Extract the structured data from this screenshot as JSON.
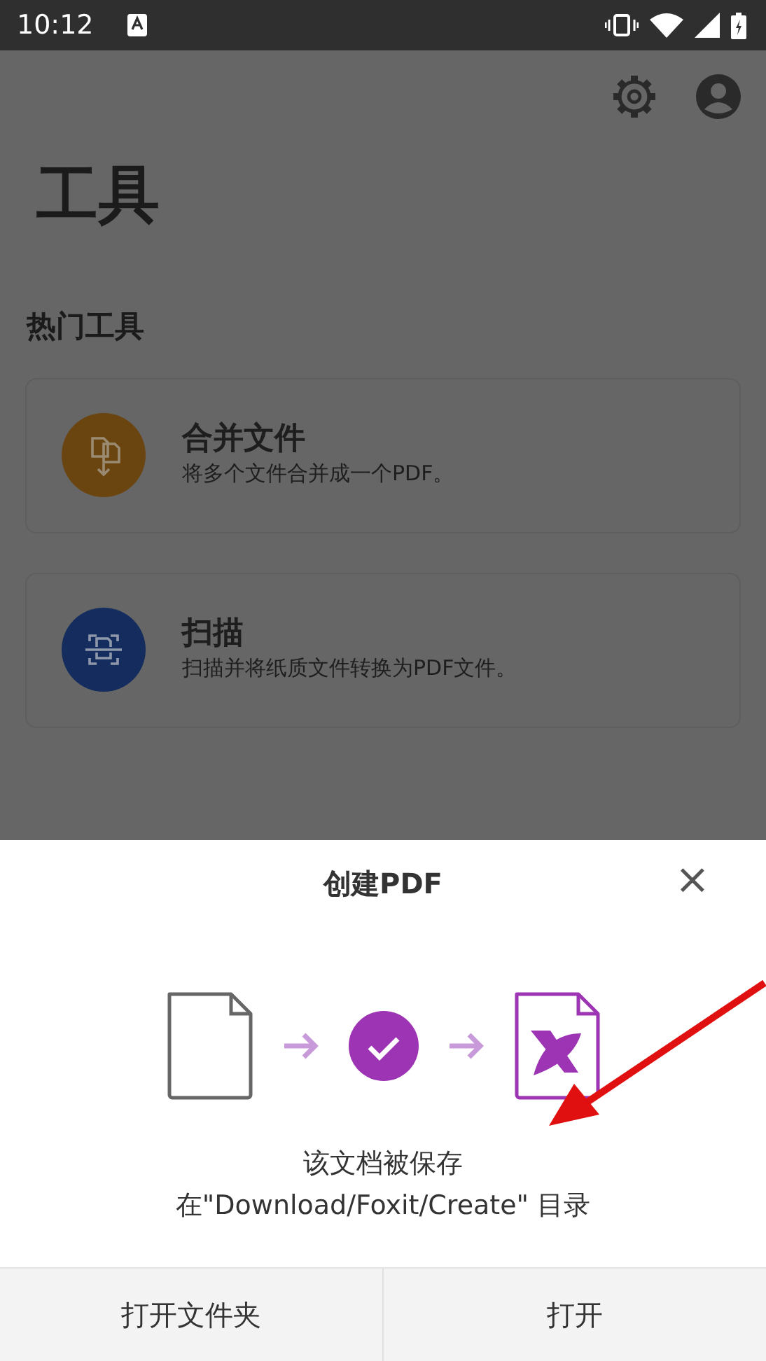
{
  "status_bar": {
    "time": "10:12"
  },
  "page": {
    "title": "工具",
    "section_title": "热门工具"
  },
  "tools": [
    {
      "kind": "merge",
      "title": "合并文件",
      "description": "将多个文件合并成一个PDF。",
      "color": "#6b4510"
    },
    {
      "kind": "scan",
      "title": "扫描",
      "description": "扫描并将纸质文件转换为PDF文件。",
      "color": "#142c5e"
    }
  ],
  "dialog": {
    "title": "创建PDF",
    "close": "×",
    "message": "该文档被保存在\"Download/Foxit/Create\" 目录",
    "buttons": [
      {
        "label": "打开文件夹"
      },
      {
        "label": "打开"
      }
    ]
  }
}
